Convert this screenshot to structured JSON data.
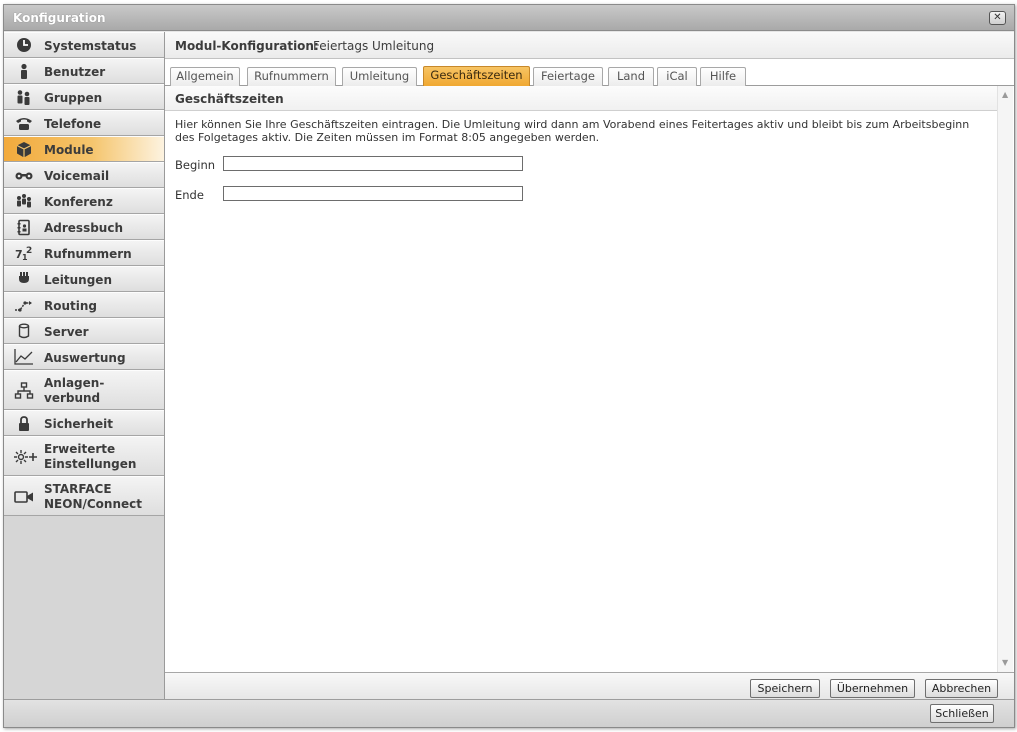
{
  "window": {
    "title": "Konfiguration",
    "close_symbol": "✕"
  },
  "sidebar": {
    "items": [
      {
        "label": "Systemstatus",
        "icon": "clock-icon"
      },
      {
        "label": "Benutzer",
        "icon": "user-icon"
      },
      {
        "label": "Gruppen",
        "icon": "group-icon"
      },
      {
        "label": "Telefone",
        "icon": "phone-icon"
      },
      {
        "label": "Module",
        "icon": "cube-icon",
        "active": true
      },
      {
        "label": "Voicemail",
        "icon": "voicemail-icon"
      },
      {
        "label": "Konferenz",
        "icon": "conference-icon"
      },
      {
        "label": "Adressbuch",
        "icon": "addressbook-icon"
      },
      {
        "label": "Rufnummern",
        "icon": "numbers-icon"
      },
      {
        "label": "Leitungen",
        "icon": "plug-icon"
      },
      {
        "label": "Routing",
        "icon": "routing-icon"
      },
      {
        "label": "Server",
        "icon": "server-icon"
      },
      {
        "label": "Auswertung",
        "icon": "chart-icon"
      },
      {
        "label_line1": "Anlagen-",
        "label_line2": "verbund",
        "icon": "network-icon"
      },
      {
        "label": "Sicherheit",
        "icon": "lock-icon"
      },
      {
        "label_line1": "Erweiterte",
        "label_line2": "Einstellungen",
        "icon": "settings-plus-icon"
      },
      {
        "label_line1": "STARFACE",
        "label_line2": "NEON/Connect",
        "icon": "camera-icon"
      }
    ]
  },
  "module_header": {
    "label": "Modul-Konfiguration:",
    "value": "Feiertags Umleitung"
  },
  "tabs": [
    {
      "label": "Allgemein"
    },
    {
      "label": "Rufnummern"
    },
    {
      "label": "Umleitung"
    },
    {
      "label": "Geschäftszeiten",
      "active": true
    },
    {
      "label": "Feiertage"
    },
    {
      "label": "Land"
    },
    {
      "label": "iCal"
    },
    {
      "label": "Hilfe"
    }
  ],
  "section": {
    "title": "Geschäftszeiten",
    "description_line1": "Hier können Sie Ihre Geschäftszeiten eintragen. Die Umleitung wird dann am Vorabend eines Feitertages aktiv und bleibt bis zum Arbeitsbeginn",
    "description_line2": "des Folgetages aktiv. Die Zeiten müssen im Format 8:05 angegeben werden.",
    "fields": [
      {
        "label": "Beginn",
        "value": ""
      },
      {
        "label": "Ende",
        "value": ""
      }
    ]
  },
  "footer": {
    "save": "Speichern",
    "apply": "Übernehmen",
    "cancel": "Abbrechen"
  },
  "bottom": {
    "close": "Schließen"
  },
  "colors": {
    "accent": "#f0a832",
    "sidebar_bg": "#d6d6d6",
    "titlebar": "#b0b0b0"
  }
}
